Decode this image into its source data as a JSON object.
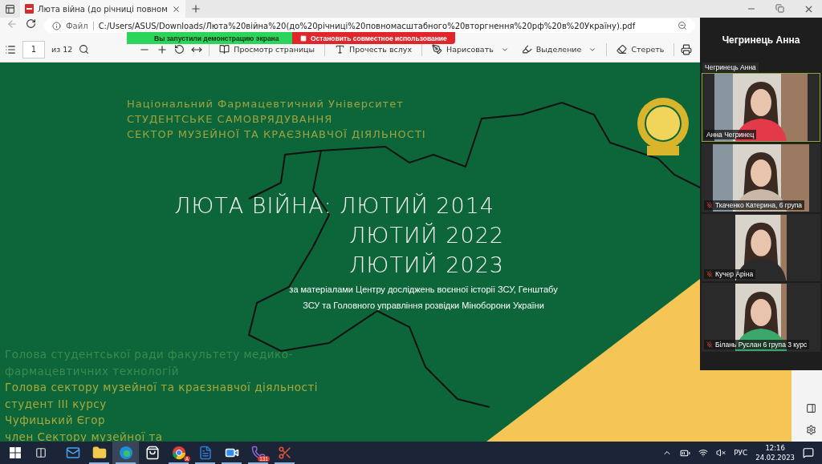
{
  "browser": {
    "tab_title": "Люта війна (до річниці повном",
    "url_scheme": "Файл",
    "url": "C:/Users/ASUS/Downloads/Люта%20війна%20(до%20річниці%20повномасштабного%20вторгнення%20рф%20в%20Україну).pdf"
  },
  "share_bar": {
    "status": "Вы запустили демонстрацию экрана",
    "stop_button": "Остановить совместное использование"
  },
  "pdf_toolbar": {
    "page": "1",
    "page_count": "из 12",
    "buttons": [
      {
        "kind": "view",
        "label": "Просмотр страницы"
      },
      {
        "kind": "read",
        "label": "Прочесть вслух"
      },
      {
        "kind": "draw",
        "label": "Нарисовать"
      },
      {
        "kind": "highlight",
        "label": "Выделение"
      },
      {
        "kind": "erase",
        "label": "Стереть"
      }
    ]
  },
  "slide": {
    "header_lines": [
      "Національний Фармацевтичний Університет",
      "СТУДЕНТСЬКЕ САМОВРЯДУВАННЯ",
      "СЕКТОР МУЗЕЙНОЇ ТА КРАЄЗНАВЧОЇ ДІЯЛЬНОСТІ"
    ],
    "title_lines": [
      "ЛЮТА ВІЙНА: ЛЮТИЙ 2014",
      "ЛЮТИЙ 2022",
      "ЛЮТИЙ 2023"
    ],
    "subtitle": "за матеріалами Центру досліджень воєнної історії ЗСУ, Генштабу ЗСУ та Головного управління розвідки Міноборони України",
    "credits": [
      {
        "text": "Голова студентської ради факультету медико-",
        "dim": true
      },
      {
        "text": "фармацевтичних технологій",
        "dim": true
      },
      {
        "text": "Голова сектору музейної та краєзнавчої діяльності",
        "dim": false
      },
      {
        "text": "студент ІІІ курсу",
        "dim": false
      },
      {
        "text": "Чуфицький Єгор",
        "dim": false
      },
      {
        "text": "член Сектору музейної та",
        "dim": false
      }
    ]
  },
  "meeting": {
    "title": "Чегринець Анна",
    "speaker_label": "Чегринець Анна",
    "participants": [
      {
        "name": "Анна Чегринец",
        "muted": false,
        "speaking": true
      },
      {
        "name": "Ткаченко Катерина, 6 група",
        "muted": true,
        "speaking": false
      },
      {
        "name": "Кучер Аріна",
        "muted": true,
        "speaking": false
      },
      {
        "name": "Білань Руслан  6 група 3 курс",
        "muted": true,
        "speaking": false
      }
    ]
  },
  "taskbar": {
    "apps": [
      {
        "kind": "mail",
        "running": false,
        "active": false
      },
      {
        "kind": "folder",
        "running": true,
        "active": false
      },
      {
        "kind": "edge",
        "running": true,
        "active": true
      },
      {
        "kind": "store",
        "running": false,
        "active": false
      },
      {
        "kind": "chrome",
        "running": true,
        "active": false,
        "badge": "A"
      },
      {
        "kind": "word",
        "running": true,
        "active": false
      },
      {
        "kind": "zoom",
        "running": true,
        "active": false
      },
      {
        "kind": "viber",
        "running": true,
        "active": false,
        "badge": "131"
      },
      {
        "kind": "snip",
        "running": true,
        "active": false
      }
    ],
    "language": "РУС",
    "time": "12:16",
    "date": "24.02.2023"
  }
}
